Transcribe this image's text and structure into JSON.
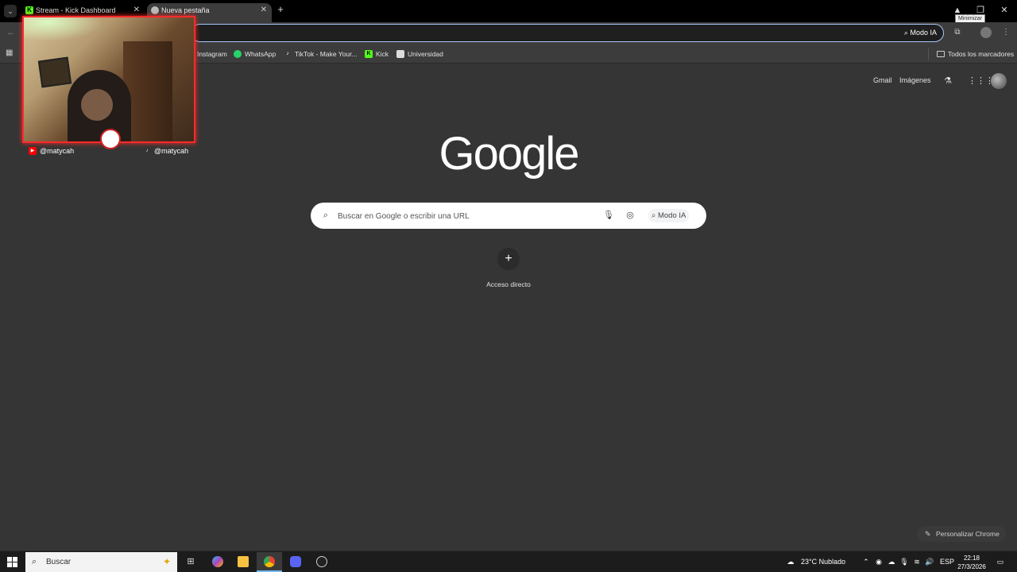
{
  "tabs": [
    {
      "title": "Stream - Kick Dashboard",
      "favicon": "kick-icon",
      "active": false
    },
    {
      "title": "Nueva pestaña",
      "favicon": "chrome-icon",
      "active": true
    }
  ],
  "window": {
    "tooltip": "Minimizar"
  },
  "toolbar": {
    "omnibox_value": "",
    "modo_ia": "Modo IA"
  },
  "bookmarks": [
    {
      "label": "Instagram",
      "icon": "instagram-icon"
    },
    {
      "label": "WhatsApp",
      "icon": "whatsapp-icon"
    },
    {
      "label": "TikTok - Make Your...",
      "icon": "tiktok-icon"
    },
    {
      "label": "Kick",
      "icon": "kick-icon"
    },
    {
      "label": "Universidad",
      "icon": "bookmark-icon"
    }
  ],
  "bookmarks_all": "Todos los marcadores",
  "webcam": {
    "youtube_handle": "@matycah",
    "tiktok_handle": "@matycah"
  },
  "header_links": {
    "gmail": "Gmail",
    "images": "Imágenes"
  },
  "logo": "Google",
  "search": {
    "placeholder": "Buscar en Google o escribir una URL",
    "modo_ia": "Modo IA"
  },
  "shortcut": {
    "label": "Acceso directo"
  },
  "customize": "Personalizar Chrome",
  "taskbar": {
    "search_placeholder": "Buscar",
    "weather": "23°C  Nublado",
    "language": "ESP",
    "time": "22:18",
    "date": "27/3/2026"
  },
  "colors": {
    "accent": "#a8c7fa",
    "webcam_border": "#ff2a2a",
    "kick": "#53fc18",
    "background": "#353535"
  }
}
